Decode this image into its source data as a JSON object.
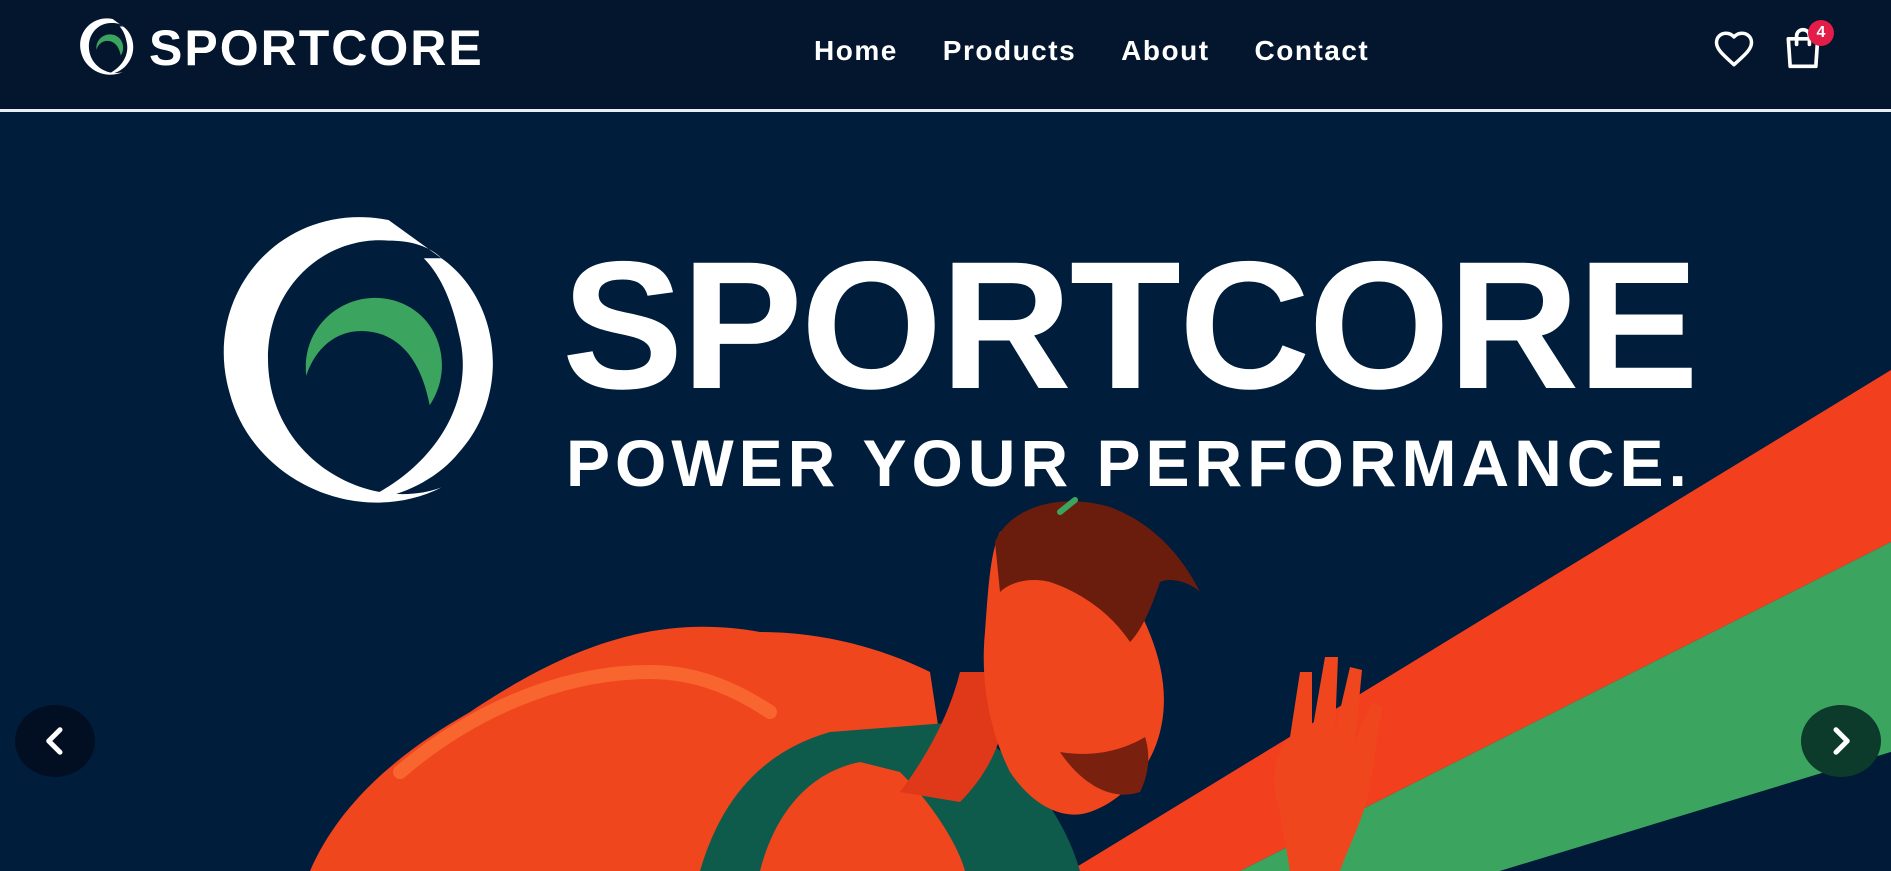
{
  "header": {
    "brand_name": "SPORTCORE",
    "nav": [
      {
        "label": "Home"
      },
      {
        "label": "Products"
      },
      {
        "label": "About"
      },
      {
        "label": "Contact"
      }
    ],
    "wishlist_icon": "heart-icon",
    "cart_icon": "shopping-bag-icon",
    "cart_count": "4"
  },
  "hero": {
    "title": "SPORTCORE",
    "tagline": "POWER YOUR PERFORMANCE.",
    "prev_icon": "chevron-left-icon",
    "next_icon": "chevron-right-icon"
  },
  "colors": {
    "header_bg": "#04152e",
    "hero_bg": "#011d3c",
    "accent_green": "#3ba55f",
    "accent_orange": "#f2401f",
    "badge_red": "#e11d48",
    "text": "#ffffff"
  }
}
